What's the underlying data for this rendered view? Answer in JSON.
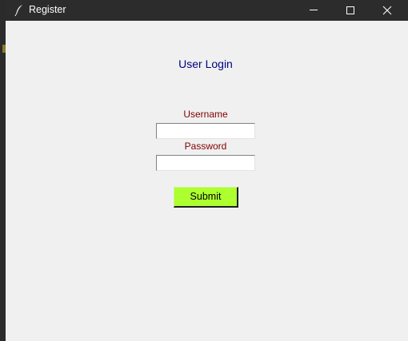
{
  "window": {
    "title": "Register",
    "controls": {
      "minimize": "minimize-icon",
      "maximize": "maximize-icon",
      "close": "close-icon"
    }
  },
  "form": {
    "heading": "User Login",
    "username_label": "Username",
    "username_value": "",
    "password_label": "Password",
    "password_value": "",
    "submit_label": "Submit"
  },
  "colors": {
    "heading": "#000080",
    "labels": "#800000",
    "submit_bg": "#adff2f",
    "titlebar": "#2c2c2c",
    "client_bg": "#f0f0f0"
  }
}
